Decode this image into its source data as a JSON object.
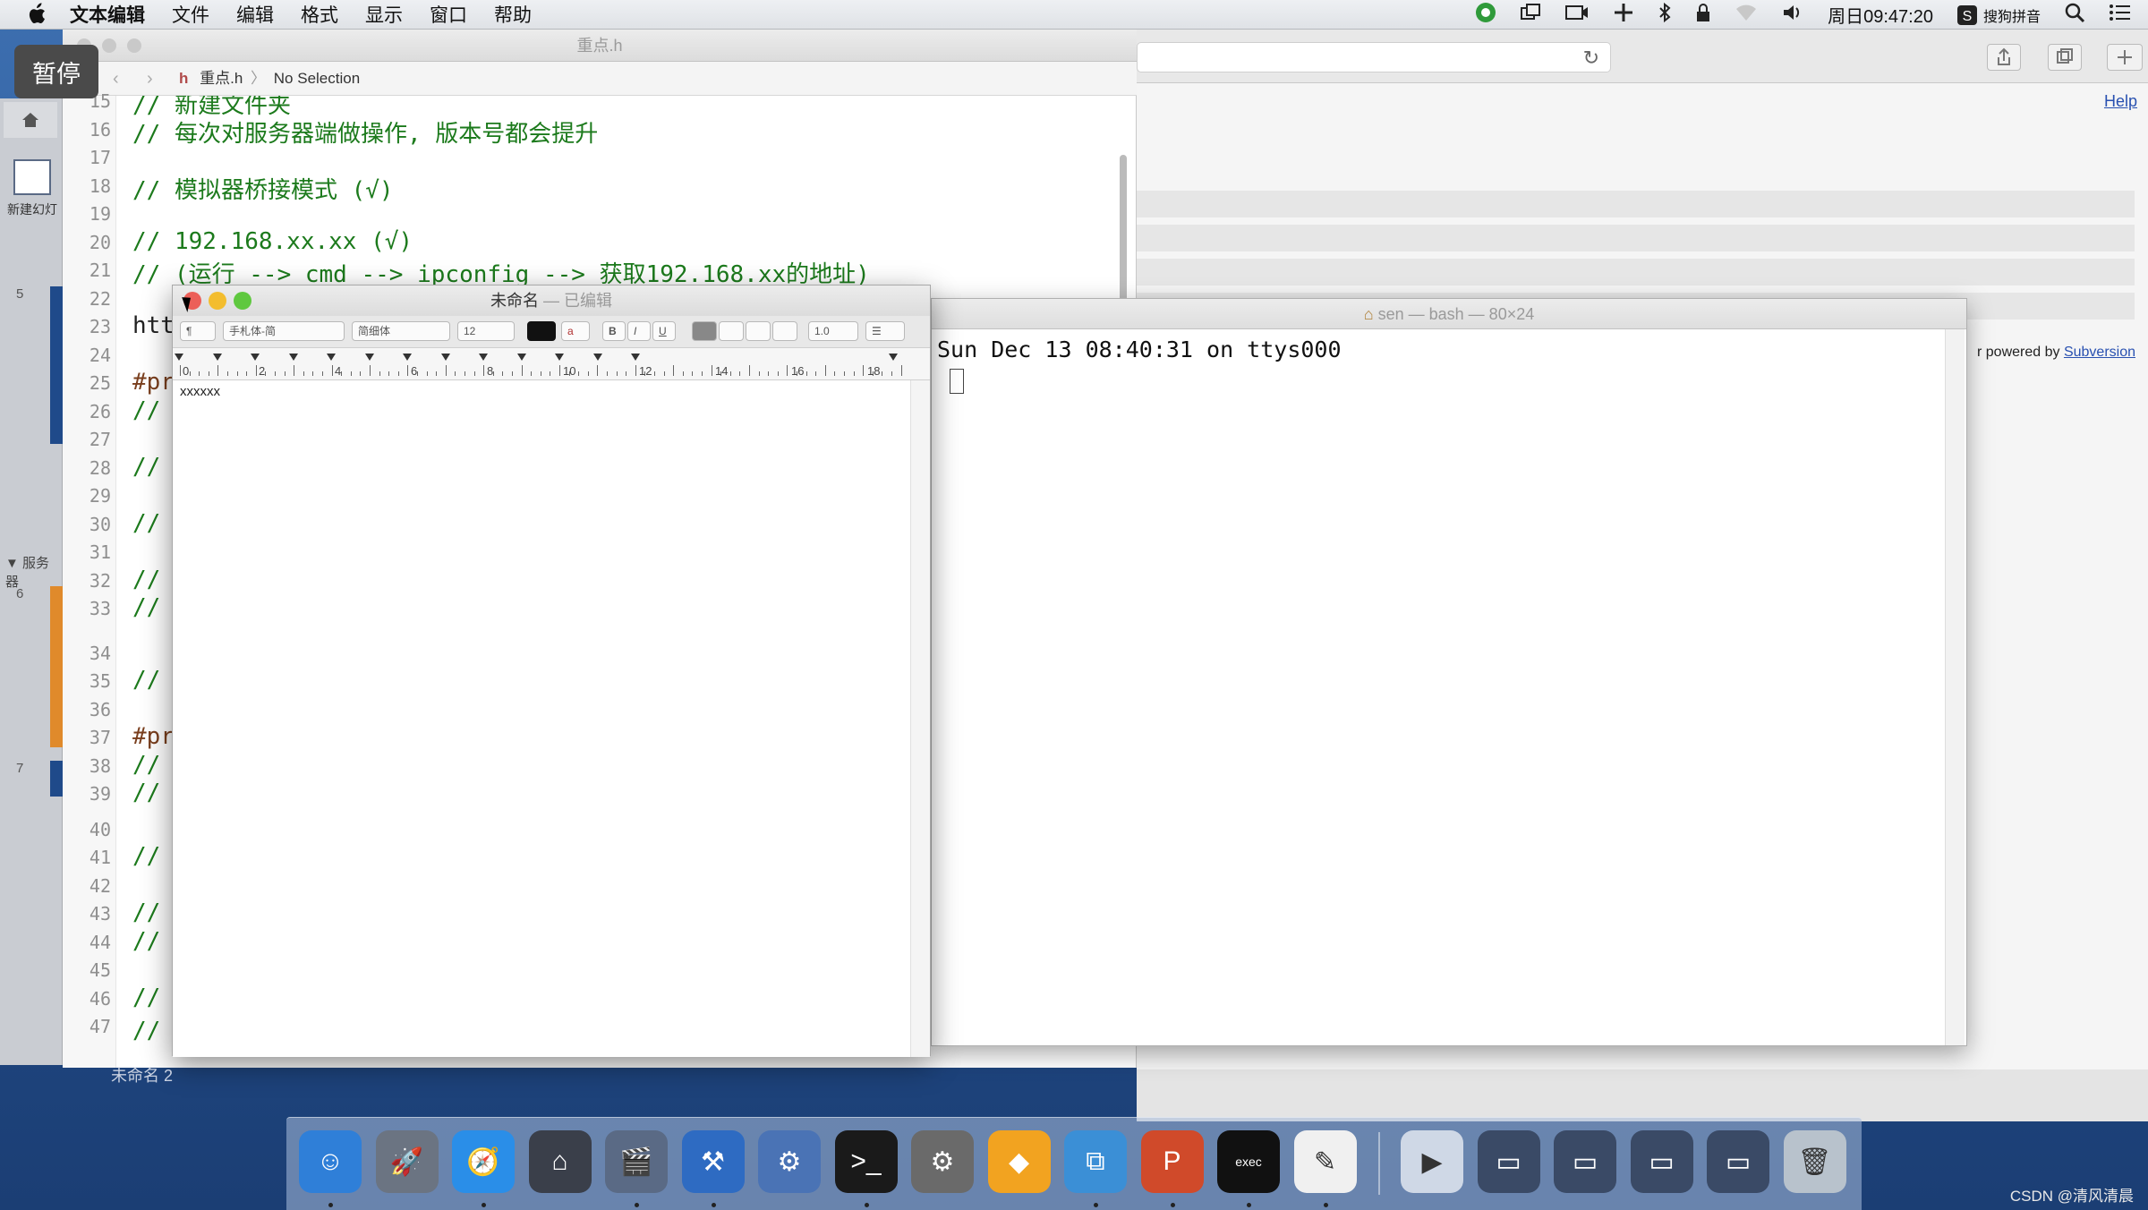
{
  "menubar": {
    "app_name": "文本编辑",
    "items": [
      "文件",
      "编辑",
      "格式",
      "显示",
      "窗口",
      "帮助"
    ],
    "clock": "周日09:47:20",
    "ime": "搜狗拼音"
  },
  "pause_badge": "暂停",
  "slides_app": {
    "new_slide_label": "新建幻灯",
    "slide_numbers": [
      "5",
      "6",
      "7"
    ],
    "group_label": "▼ 服务器"
  },
  "xcode": {
    "window_title": "重点.h",
    "jump_file": "重点.h",
    "jump_selection": "No Selection",
    "lines": [
      {
        "no": "15",
        "text": "// 新建文件夹",
        "kind": "comment"
      },
      {
        "no": "16",
        "text": "// 每次对服务器端做操作, 版本号都会提升",
        "kind": "comment"
      },
      {
        "no": "17",
        "text": "",
        "kind": "plain"
      },
      {
        "no": "18",
        "text": "// 模拟器桥接模式 (√)",
        "kind": "comment"
      },
      {
        "no": "19",
        "text": "",
        "kind": "plain"
      },
      {
        "no": "20",
        "text": "// 192.168.xx.xx (√)",
        "kind": "comment"
      },
      {
        "no": "21",
        "text": "// (运行 --> cmd --> ipconfig --> 获取192.168.xx的地址)",
        "kind": "comment"
      },
      {
        "no": "22",
        "text": "",
        "kind": "plain"
      },
      {
        "no": "23",
        "text": "htt",
        "kind": "plain"
      },
      {
        "no": "24",
        "text": "",
        "kind": "plain"
      },
      {
        "no": "25",
        "text": "#pr",
        "kind": "directive"
      },
      {
        "no": "26",
        "text": "//",
        "kind": "comment"
      },
      {
        "no": "27",
        "text": "",
        "kind": "plain"
      },
      {
        "no": "28",
        "text": "//",
        "kind": "comment"
      },
      {
        "no": "29",
        "text": "",
        "kind": "plain"
      },
      {
        "no": "30",
        "text": "//",
        "kind": "comment"
      },
      {
        "no": "31",
        "text": "",
        "kind": "plain"
      },
      {
        "no": "32",
        "text": "//",
        "kind": "comment"
      },
      {
        "no": "33",
        "text": "//",
        "kind": "comment"
      },
      {
        "no": "34",
        "text": "",
        "kind": "plain"
      },
      {
        "no": "35",
        "text": "//",
        "kind": "comment"
      },
      {
        "no": "36",
        "text": "",
        "kind": "plain"
      },
      {
        "no": "37",
        "text": "#pr",
        "kind": "directive"
      },
      {
        "no": "38",
        "text": "//",
        "kind": "comment"
      },
      {
        "no": "39",
        "text": "//",
        "kind": "comment"
      },
      {
        "no": "40",
        "text": "",
        "kind": "plain"
      },
      {
        "no": "41",
        "text": "//",
        "kind": "comment"
      },
      {
        "no": "42",
        "text": "",
        "kind": "plain"
      },
      {
        "no": "43",
        "text": "//",
        "kind": "comment"
      },
      {
        "no": "44",
        "text": "//",
        "kind": "comment"
      },
      {
        "no": "45",
        "text": "",
        "kind": "plain"
      },
      {
        "no": "46",
        "text": "//",
        "kind": "comment"
      },
      {
        "no": "47",
        "text": "// svn commit -m \"这里写message\"",
        "kind": "comment"
      }
    ]
  },
  "textedit": {
    "title": "未命名",
    "title_status": "— 已编辑",
    "paragraph_style": "¶",
    "font_family": "手札体-简",
    "font_style": "简细体",
    "font_size": "12",
    "line_spacing": "1.0",
    "ruler_numbers": [
      "0",
      "2",
      "4",
      "6",
      "8",
      "10",
      "12",
      "14",
      "16",
      "18"
    ],
    "content": "xxxxxx"
  },
  "terminal": {
    "title": "sen — bash — 80×24",
    "login_line": "Sun Dec 13 08:40:31 on ttys000"
  },
  "browser": {
    "help_link": "Help",
    "powered_text": "r powered by",
    "powered_link": "Subversion"
  },
  "below_label": "未命名 2",
  "dock": {
    "items": [
      "finder-icon",
      "launchpad-icon",
      "safari-icon",
      "mouse-icon",
      "keynote-icon",
      "xcode-icon",
      "instruments-icon",
      "terminal-icon",
      "system-preferences-icon",
      "sketch-icon",
      "cornerstone-icon",
      "powerpoint-icon",
      "exec-icon",
      "textedit-icon",
      "screenflow-icon",
      "presentation-1-icon",
      "presentation-2-icon",
      "presentation-3-icon",
      "presentation-4-icon",
      "trash-icon"
    ]
  },
  "watermark": "CSDN @清风清晨",
  "colors": {
    "comment_green": "#1c7a1c",
    "directive_brown": "#7a3f1e",
    "close_red": "#ec5f58",
    "minimize_yellow": "#f3bd2e",
    "zoom_green": "#5fc83f"
  }
}
